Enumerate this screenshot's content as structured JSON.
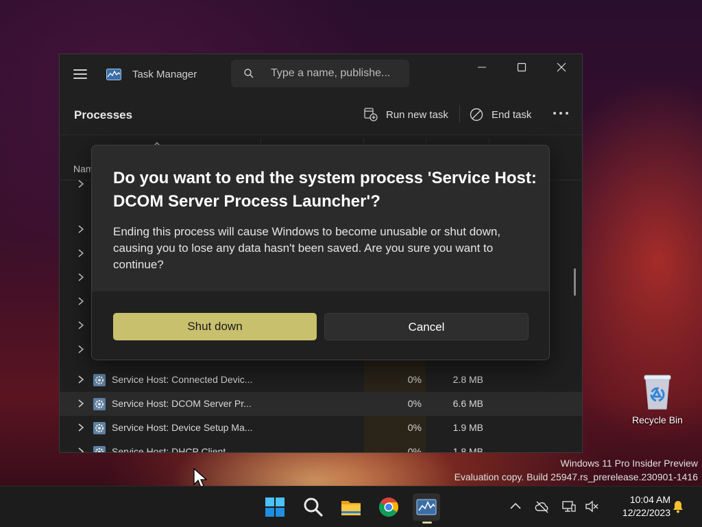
{
  "window": {
    "title": "Task Manager",
    "search_placeholder": "Type a name, publishe...",
    "page_title": "Processes",
    "run_new_task_label": "Run new task",
    "end_task_label": "End task",
    "name_column_label": "Nam"
  },
  "processes": [
    {
      "name": "Service Host: Connected Devic...",
      "cpu": "0%",
      "memory": "2.8 MB"
    },
    {
      "name": "Service Host: DCOM Server Pr...",
      "cpu": "0%",
      "memory": "6.6 MB"
    },
    {
      "name": "Service Host: Device Setup Ma...",
      "cpu": "0%",
      "memory": "1.9 MB"
    },
    {
      "name": "Service Host: DHCP Client",
      "cpu": "0%",
      "memory": "1.8 MB"
    }
  ],
  "dialog": {
    "title": "Do you want to end the system process 'Service Host: DCOM Server Process Launcher'?",
    "message": "Ending this process will cause Windows to become unusable or shut down, causing you to lose any data hasn't been saved. Are you sure you want to continue?",
    "primary_button": "Shut down",
    "secondary_button": "Cancel"
  },
  "desktop": {
    "recycle_bin_label": "Recycle Bin",
    "watermark_line1": "Windows 11 Pro Insider Preview",
    "watermark_line2": "Evaluation copy. Build 25947.rs_prerelease.230901-1416"
  },
  "taskbar": {
    "apps": [
      "start-icon",
      "search-icon",
      "file-explorer-icon",
      "chrome-icon",
      "task-manager-icon"
    ],
    "time": "10:04 AM",
    "date": "12/22/2023"
  },
  "colors": {
    "accent": "#c9c06e",
    "dialog_bg": "#2b2b2b",
    "window_bg": "#1f1f1f"
  }
}
